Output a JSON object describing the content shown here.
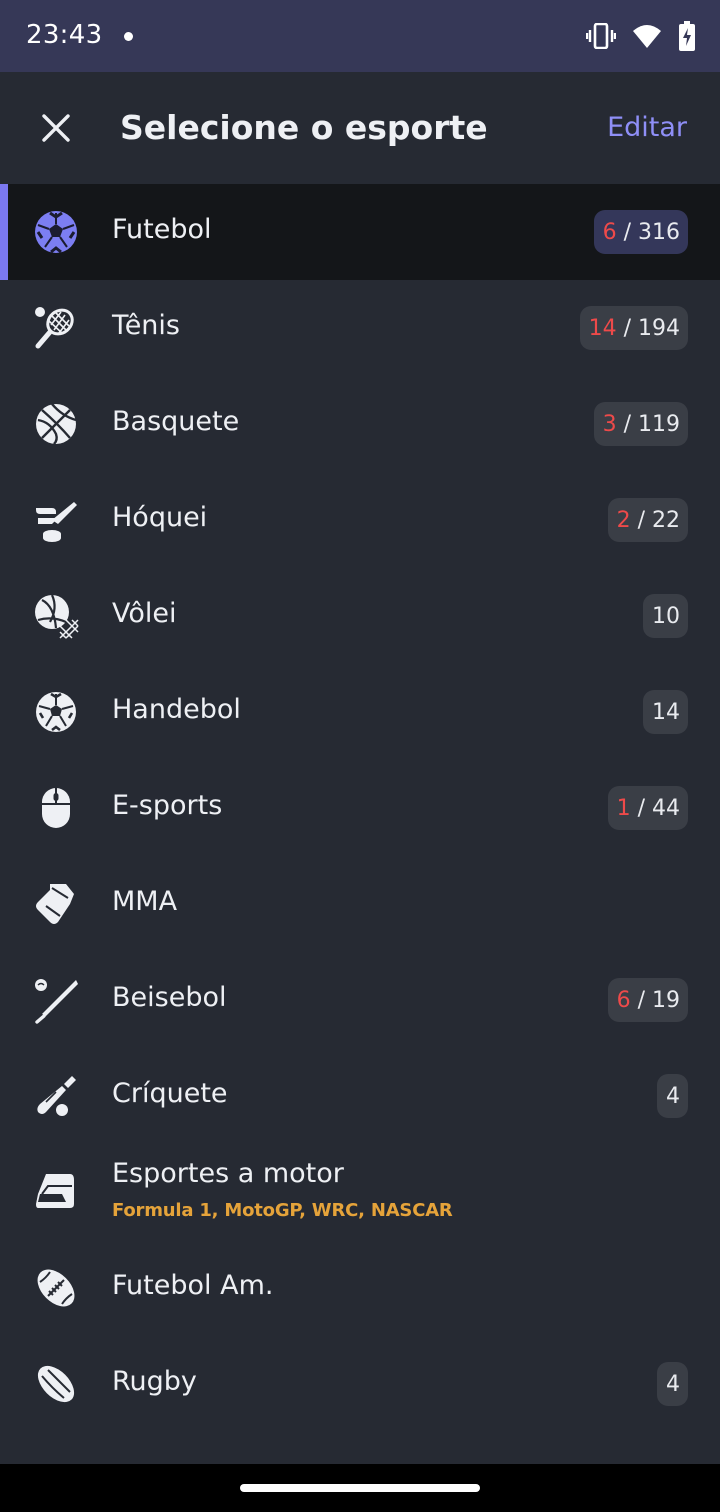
{
  "status_bar": {
    "time": "23:43"
  },
  "header": {
    "title": "Selecione o esporte",
    "edit_label": "Editar"
  },
  "sports": [
    {
      "name": "Futebol",
      "icon": "soccer-ball-icon",
      "live": "6",
      "total": "316",
      "selected": true
    },
    {
      "name": "Tênis",
      "icon": "tennis-racket-icon",
      "live": "14",
      "total": "194"
    },
    {
      "name": "Basquete",
      "icon": "basketball-icon",
      "live": "3",
      "total": "119"
    },
    {
      "name": "Hóquei",
      "icon": "hockey-icon",
      "live": "2",
      "total": "22"
    },
    {
      "name": "Vôlei",
      "icon": "volleyball-icon",
      "total": "10"
    },
    {
      "name": "Handebol",
      "icon": "handball-icon",
      "total": "14"
    },
    {
      "name": "E-sports",
      "icon": "mouse-icon",
      "live": "1",
      "total": "44"
    },
    {
      "name": "MMA",
      "icon": "glove-icon"
    },
    {
      "name": "Beisebol",
      "icon": "baseball-bat-icon",
      "live": "6",
      "total": "19"
    },
    {
      "name": "Críquete",
      "icon": "cricket-bat-icon",
      "total": "4"
    },
    {
      "name": "Esportes a motor",
      "icon": "motor-helmet-icon",
      "subtitle": "Formula 1, MotoGP, WRC, NASCAR"
    },
    {
      "name": "Futebol Am.",
      "icon": "american-football-icon"
    },
    {
      "name": "Rugby",
      "icon": "rugby-ball-icon",
      "total": "4"
    }
  ],
  "colors": {
    "accent": "#7b78f0",
    "live": "#ee4a4a",
    "subtitle": "#e5a33a",
    "background": "#262a33",
    "status_bar": "#363857"
  }
}
